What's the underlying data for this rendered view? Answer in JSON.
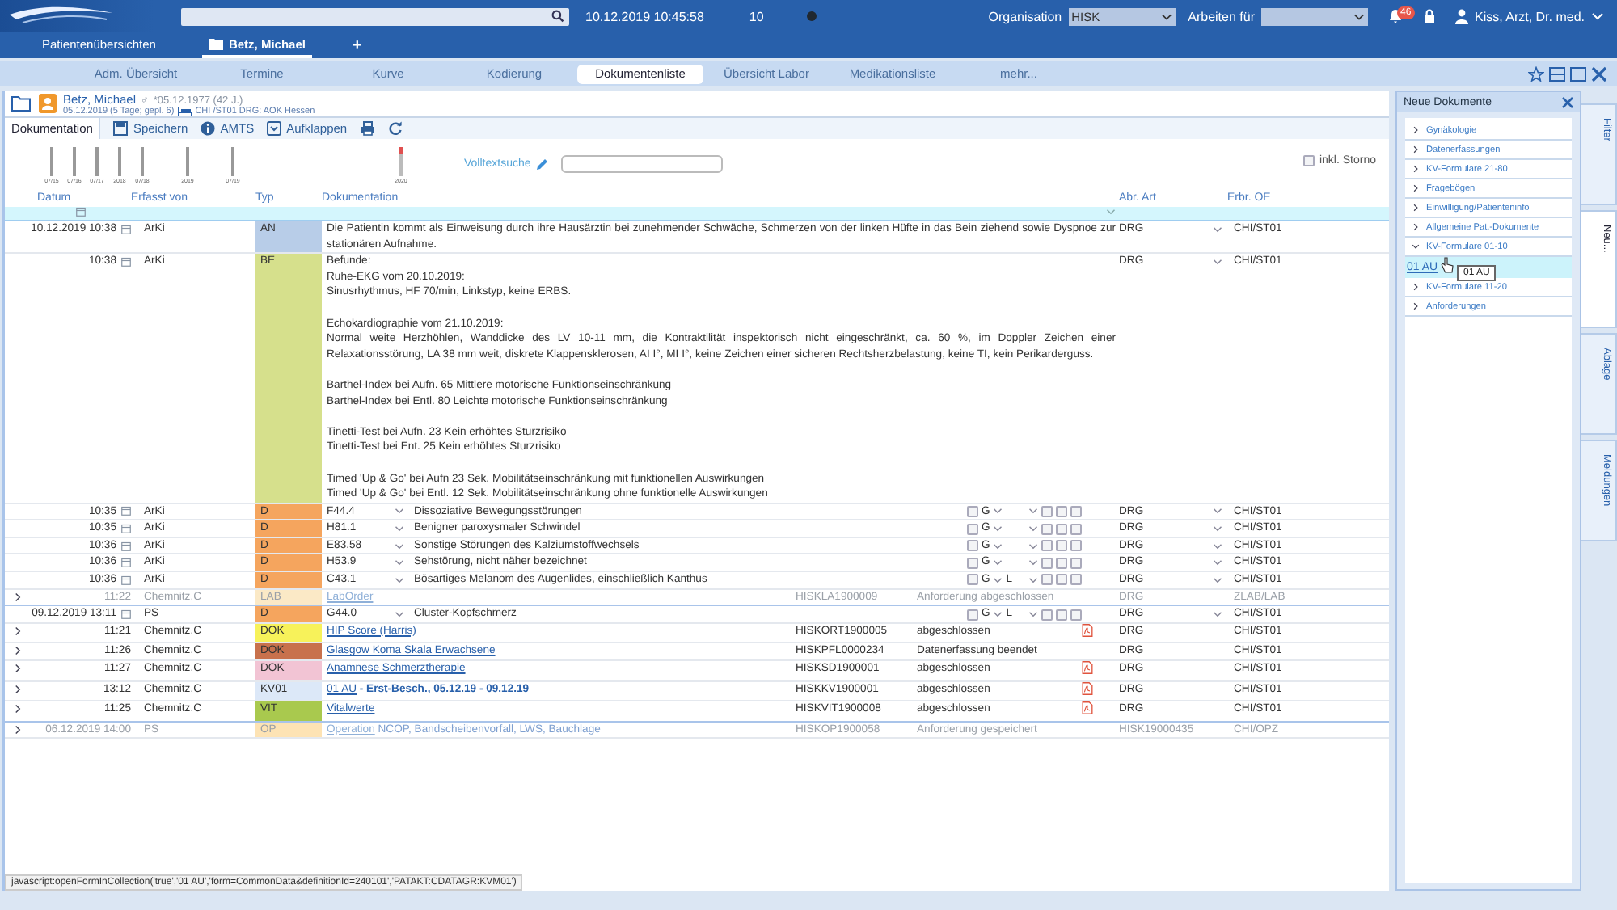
{
  "top_bar": {
    "datetime": "10.12.2019 10:45:58",
    "counter": "10",
    "organisation_label": "Organisation",
    "organisation_value": "HISK",
    "work_for_label": "Arbeiten für",
    "notifications": "46",
    "user": "Kiss, Arzt, Dr. med."
  },
  "tabs": [
    {
      "label": "Patientenübersichten",
      "selected": false
    },
    {
      "label": "Betz, Michael",
      "selected": true
    }
  ],
  "add_tab": "+",
  "nav": [
    {
      "label": "Adm. Übersicht",
      "selected": false
    },
    {
      "label": "Termine",
      "selected": false
    },
    {
      "label": "Kurve",
      "selected": false
    },
    {
      "label": "Kodierung",
      "selected": false
    },
    {
      "label": "Dokumentenliste",
      "selected": true
    },
    {
      "label": "Übersicht Labor",
      "selected": false
    },
    {
      "label": "Medikationsliste",
      "selected": false
    },
    {
      "label": "mehr...",
      "selected": false
    }
  ],
  "patient": {
    "name": "Betz, Michael",
    "gender": "♂",
    "birth": "*05.12.1977 (42 J.)",
    "admission": "05.12.2019 (5 Tage; gepl. 6)",
    "ward": "CHI /ST01 DRG: AOK Hessen"
  },
  "toolbar": {
    "tab": "Dokumentation",
    "actions": [
      {
        "kind": "save",
        "label": "Speichern"
      },
      {
        "kind": "info",
        "label": "AMTS"
      },
      {
        "kind": "expand",
        "label": "Aufklappen"
      },
      {
        "kind": "print"
      },
      {
        "kind": "refresh"
      }
    ]
  },
  "timeline": {
    "labels": [
      "07/15",
      "07/16",
      "07/17",
      "2018",
      "07/18",
      "2019",
      "07/19",
      "2020"
    ],
    "search_label": "Volltextsuche",
    "storno_label": "inkl. Storno",
    "storno_checked": false
  },
  "columns": [
    "Datum",
    "Erfasst von",
    "Typ",
    "Dokumentation",
    "Abr. Art",
    "Erbr. OE"
  ],
  "rows": [
    {
      "kind": "note",
      "expandable": false,
      "muted": false,
      "datum": "10.12.2019 10:38",
      "author": "ArKi",
      "type": "AN",
      "color": "#b8cde8",
      "groups": [
        [
          "Die Patientin kommt als Einweisung durch ihre Hausärztin bei zunehmender Schwäche, Schmerzen von der linken Hüfte in das Bein ziehend sowie Dyspnoe zur stationären Aufnahme."
        ]
      ],
      "billing": "DRG",
      "unit": "CHI/ST01"
    },
    {
      "kind": "note",
      "expandable": false,
      "muted": false,
      "datum": "10:38",
      "author": "ArKi",
      "type": "BE",
      "color": "#d6e08c",
      "groups": [
        [
          "Befunde:",
          "Ruhe-EKG vom 20.10.2019:",
          "Sinusrhythmus, HF 70/min, Linkstyp, keine ERBS."
        ],
        [
          "Echokardiographie vom 21.10.2019:",
          "Normal weite Herzhöhlen, Wanddicke des LV 10-11 mm, die Kontraktilität inspektorisch nicht eingeschränkt, ca. 60 %, im Doppler Zeichen einer Relaxationsstörung, LA 38 mm weit, diskrete Klappensklerosen, AI I°, MI I°, keine Zeichen einer sicheren Rechtsherzbelastung, keine TI, kein Perikarderguss."
        ],
        [
          "Barthel-Index bei Aufn. 65 Mittlere motorische Funktionseinschränkung",
          "Barthel-Index bei Entl. 80 Leichte motorische Funktionseinschränkung"
        ],
        [
          "Tinetti-Test bei Aufn. 23 Kein erhöhtes Sturzrisiko",
          "Tinetti-Test bei Ent. 25 Kein erhöhtes Sturzrisiko"
        ],
        [
          "Timed 'Up & Go' bei Aufn 23 Sek. Mobilitätseinschränkung mit funktionellen Auswirkungen",
          "Timed 'Up & Go' bei Entl. 12 Sek. Mobilitätseinschränkung ohne funktionelle Auswirkungen"
        ]
      ],
      "billing": "DRG",
      "unit": "CHI/ST01"
    },
    {
      "kind": "diagnosis",
      "expandable": false,
      "muted": false,
      "datum": "10:35",
      "author": "ArKi",
      "type": "D",
      "color": "#f5a55e",
      "code": "F44.4",
      "text": "Dissoziative Bewegungsstörungen",
      "certainty": "G",
      "checks": [
        false,
        false,
        false,
        false
      ],
      "billing": "DRG",
      "unit": "CHI/ST01"
    },
    {
      "kind": "diagnosis",
      "expandable": false,
      "muted": false,
      "datum": "10:35",
      "author": "ArKi",
      "type": "D",
      "color": "#f5a55e",
      "code": "H81.1",
      "text": "Benigner paroxysmaler Schwindel",
      "certainty": "G",
      "checks": [
        false,
        false,
        false,
        false
      ],
      "billing": "DRG",
      "unit": "CHI/ST01"
    },
    {
      "kind": "diagnosis",
      "expandable": false,
      "muted": false,
      "datum": "10:36",
      "author": "ArKi",
      "type": "D",
      "color": "#f5a55e",
      "code": "E83.58",
      "text": "Sonstige Störungen des Kalziumstoffwechsels",
      "certainty": "G",
      "checks": [
        false,
        false,
        false,
        false
      ],
      "billing": "DRG",
      "unit": "CHI/ST01"
    },
    {
      "kind": "diagnosis",
      "expandable": false,
      "muted": false,
      "datum": "10:36",
      "author": "ArKi",
      "type": "D",
      "color": "#f5a55e",
      "code": "H53.9",
      "text": "Sehstörung, nicht näher bezeichnet",
      "certainty": "G",
      "checks": [
        false,
        false,
        false,
        false
      ],
      "billing": "DRG",
      "unit": "CHI/ST01"
    },
    {
      "kind": "diagnosis",
      "expandable": false,
      "muted": false,
      "datum": "10:36",
      "author": "ArKi",
      "type": "D",
      "color": "#f5a55e",
      "code": "C43.1",
      "text": "Bösartiges Melanom des Augenlides, einschließlich Kanthus",
      "certainty": "G",
      "checks": [
        false,
        false,
        false,
        false
      ],
      "side": "L",
      "billing": "DRG",
      "unit": "CHI/ST01"
    },
    {
      "kind": "document",
      "expandable": true,
      "muted": true,
      "separator_after": true,
      "datum": "11:22",
      "author": "Chemnitz.C",
      "type": "LAB",
      "color": "#fbe9c6",
      "link": "LabOrder",
      "reference": "HISKLA1900009",
      "status": "Anforderung abgeschlossen",
      "pdf": false,
      "billing": "DRG",
      "unit": "ZLAB/LAB"
    },
    {
      "kind": "diagnosis",
      "expandable": false,
      "muted": false,
      "datum": "09.12.2019 13:11",
      "author": "PS",
      "type": "D",
      "color": "#f5a55e",
      "code": "G44.0",
      "text": "Cluster-Kopfschmerz",
      "certainty": "G",
      "checks": [
        false,
        false,
        false,
        false
      ],
      "side": "L",
      "billing": "DRG",
      "unit": "CHI/ST01"
    },
    {
      "kind": "document",
      "expandable": true,
      "muted": false,
      "datum": "11:21",
      "author": "Chemnitz.C",
      "type": "DOK",
      "color": "#f7f25a",
      "link": "HIP Score (Harris)",
      "reference": "HISKORT1900005",
      "status": "abgeschlossen",
      "pdf": true,
      "billing": "DRG",
      "unit": "CHI/ST01"
    },
    {
      "kind": "document",
      "expandable": true,
      "muted": false,
      "datum": "11:26",
      "author": "Chemnitz.C",
      "type": "DOK",
      "color": "#c8714c",
      "link": "Glasgow Koma Skala Erwachsene",
      "reference": "HISKPFL0000234",
      "status": "Datenerfassung beendet",
      "pdf": false,
      "billing": "DRG",
      "unit": "CHI/ST01"
    },
    {
      "kind": "document",
      "expandable": true,
      "muted": false,
      "datum": "11:27",
      "author": "Chemnitz.C",
      "type": "DOK",
      "color": "#f2c4d4",
      "link": "Anamnese Schmerztherapie",
      "reference": "HISKSD1900001",
      "status": "abgeschlossen",
      "pdf": true,
      "billing": "DRG",
      "unit": "CHI/ST01"
    },
    {
      "kind": "document",
      "expandable": true,
      "muted": false,
      "datum": "13:12",
      "author": "Chemnitz.C",
      "type": "KV01",
      "color": "#dce8f8",
      "link": "01 AU",
      "extra": " - Erst-Besch., 05.12.19 - 09.12.19",
      "extra_bold": true,
      "reference": "HISKKV1900001",
      "status": "abgeschlossen",
      "pdf": true,
      "billing": "DRG",
      "unit": "CHI/ST01"
    },
    {
      "kind": "document",
      "expandable": true,
      "muted": false,
      "separator_after": true,
      "datum": "11:25",
      "author": "Chemnitz.C",
      "type": "VIT",
      "color": "#a9c94e",
      "link": "Vitalwerte",
      "reference": "HISKVIT1900008",
      "status": "abgeschlossen",
      "pdf": true,
      "billing": "DRG",
      "unit": "CHI/ST01"
    },
    {
      "kind": "document",
      "expandable": true,
      "muted": true,
      "datum": "06.12.2019 14:00",
      "author": "PS",
      "type": "OP",
      "color": "#fde3b4",
      "link": "Operation",
      "extra": "NCOP, Bandscheibenvorfall, LWS, Bauchlage",
      "extra_bold": false,
      "reference": "HISKOP1900058",
      "status": "Anforderung gespeichert",
      "pdf": false,
      "billing": "HISK19000435",
      "unit": "CHI/OPZ"
    }
  ],
  "panel": {
    "title": "Neue Dokumente",
    "tooltip": "01 AU",
    "items": [
      {
        "label": "Gynäkologie",
        "expanded": false
      },
      {
        "label": "Datenerfassungen",
        "expanded": false
      },
      {
        "label": "KV-Formulare 21-80",
        "expanded": false
      },
      {
        "label": "Fragebögen",
        "expanded": false
      },
      {
        "label": "Einwilligung/Patienteninfo",
        "expanded": false
      },
      {
        "label": "Allgemeine Pat.-Dokumente",
        "expanded": false
      },
      {
        "label": "KV-Formulare 01-10",
        "expanded": true,
        "children": [
          {
            "label": "01 AU",
            "selected": true
          }
        ]
      },
      {
        "label": "KV-Formulare 11-20",
        "expanded": false
      },
      {
        "label": "Anforderungen",
        "expanded": false
      }
    ]
  },
  "side_tabs": [
    {
      "label": "Filter",
      "selected": false
    },
    {
      "label": "Neu...",
      "selected": true
    },
    {
      "label": "Ablage",
      "selected": false
    },
    {
      "label": "Meldungen",
      "selected": false
    }
  ],
  "status_bar": "javascript:openFormInCollection('true','01 AU','form=CommonData&definitionId=240101','PATAKT:CDATAGR:KVM01')"
}
